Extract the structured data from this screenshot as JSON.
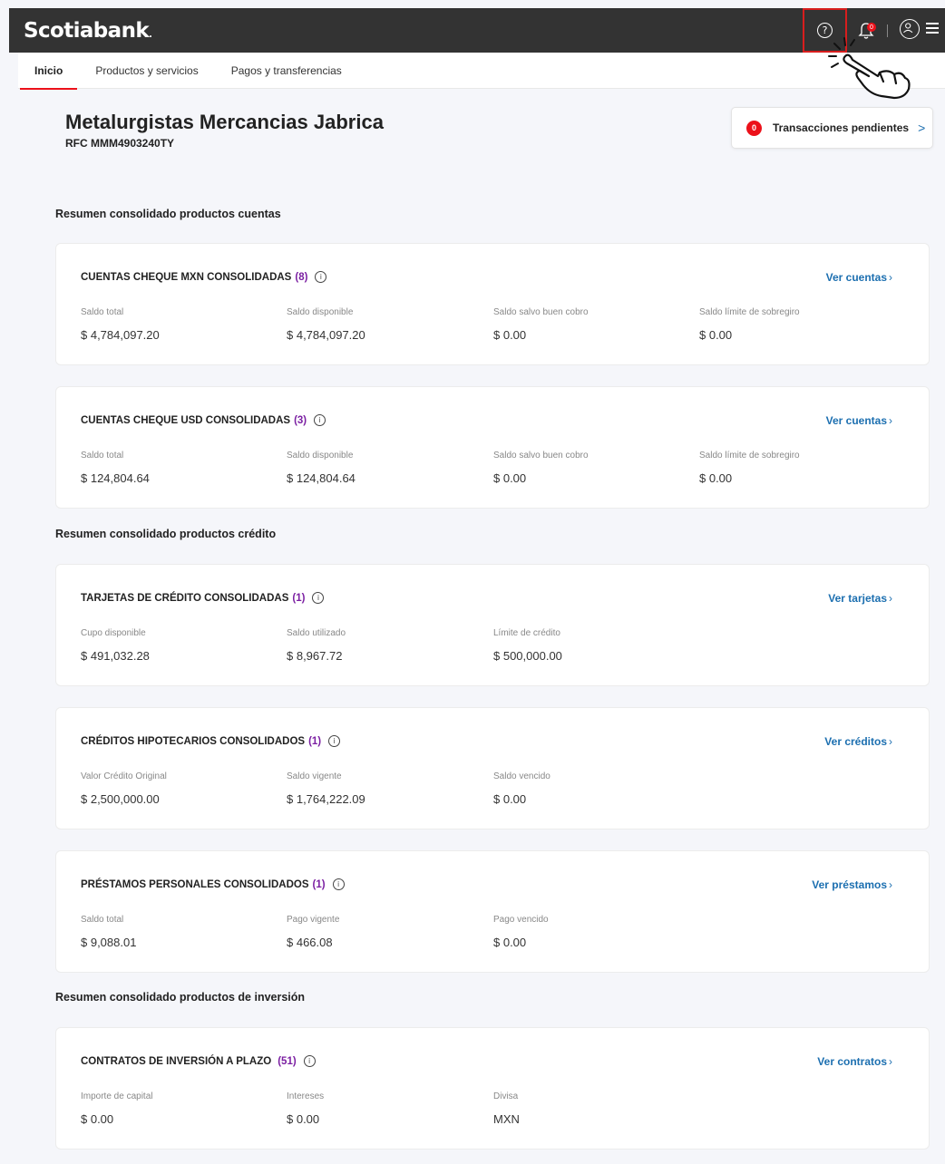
{
  "brand": {
    "name": "Scotiabank",
    "dot": "."
  },
  "topbar": {
    "help_icon": "?",
    "notifications_count": "0"
  },
  "nav": {
    "tabs": [
      {
        "label": "Inicio",
        "active": true
      },
      {
        "label": "Productos y servicios",
        "active": false
      },
      {
        "label": "Pagos y transferencias",
        "active": false
      }
    ]
  },
  "company": {
    "name": "Metalurgistas Mercancias Jabrica",
    "rfc": "RFC MMM4903240TY"
  },
  "pending": {
    "count": "0",
    "label": "Transacciones pendientes",
    "chevron": ">"
  },
  "sections": [
    {
      "title": "Resumen consolidado productos cuentas"
    },
    {
      "title": "Resumen consolidado productos crédito"
    },
    {
      "title": "Resumen consolidado productos de inversión"
    }
  ],
  "cards": [
    {
      "title": "CUENTAS CHEQUE MXN CONSOLIDADAS",
      "count": "(8)",
      "link": "Ver cuentas",
      "cols": [
        {
          "label": "Saldo total",
          "value": "$ 4,784,097.20"
        },
        {
          "label": "Saldo disponible",
          "value": "$ 4,784,097.20"
        },
        {
          "label": "Saldo salvo buen cobro",
          "value": "$ 0.00"
        },
        {
          "label": "Saldo límite de sobregiro",
          "value": "$ 0.00"
        }
      ]
    },
    {
      "title": "CUENTAS CHEQUE USD CONSOLIDADAS",
      "count": "(3)",
      "link": "Ver cuentas",
      "cols": [
        {
          "label": "Saldo total",
          "value": "$ 124,804.64"
        },
        {
          "label": "Saldo disponible",
          "value": "$ 124,804.64"
        },
        {
          "label": "Saldo salvo buen cobro",
          "value": "$ 0.00"
        },
        {
          "label": "Saldo límite de sobregiro",
          "value": "$ 0.00"
        }
      ]
    },
    {
      "title": "TARJETAS DE CRÉDITO CONSOLIDADAS",
      "count": "(1)",
      "link": "Ver tarjetas",
      "cols": [
        {
          "label": "Cupo disponible",
          "value": "$ 491,032.28"
        },
        {
          "label": "Saldo utilizado",
          "value": "$ 8,967.72"
        },
        {
          "label": "Límite de crédito",
          "value": "$ 500,000.00"
        }
      ]
    },
    {
      "title": "CRÉDITOS HIPOTECARIOS CONSOLIDADOS",
      "count": "(1)",
      "link": "Ver créditos",
      "cols": [
        {
          "label": "Valor Crédito Original",
          "value": "$ 2,500,000.00"
        },
        {
          "label": "Saldo vigente",
          "value": "$ 1,764,222.09"
        },
        {
          "label": "Saldo vencido",
          "value": "$ 0.00"
        }
      ]
    },
    {
      "title": "PRÉSTAMOS PERSONALES CONSOLIDADOS",
      "count": "(1)",
      "link": "Ver préstamos",
      "cols": [
        {
          "label": "Saldo total",
          "value": "$ 9,088.01"
        },
        {
          "label": "Pago vigente",
          "value": "$ 466.08"
        },
        {
          "label": "Pago vencido",
          "value": "$ 0.00"
        }
      ]
    },
    {
      "title": "CONTRATOS DE INVERSIÓN A PLAZO",
      "count": "(51)",
      "link": "Ver contratos",
      "cols": [
        {
          "label": "Importe de capital",
          "value": "$ 0.00"
        },
        {
          "label": "Intereses",
          "value": "$ 0.00"
        },
        {
          "label": "Divisa",
          "value": "MXN"
        }
      ]
    }
  ],
  "colors": {
    "topbar": "#333333",
    "accent_red": "#ec111a",
    "link_blue": "#1c6fb0",
    "count_purple": "#7b1fa2"
  }
}
